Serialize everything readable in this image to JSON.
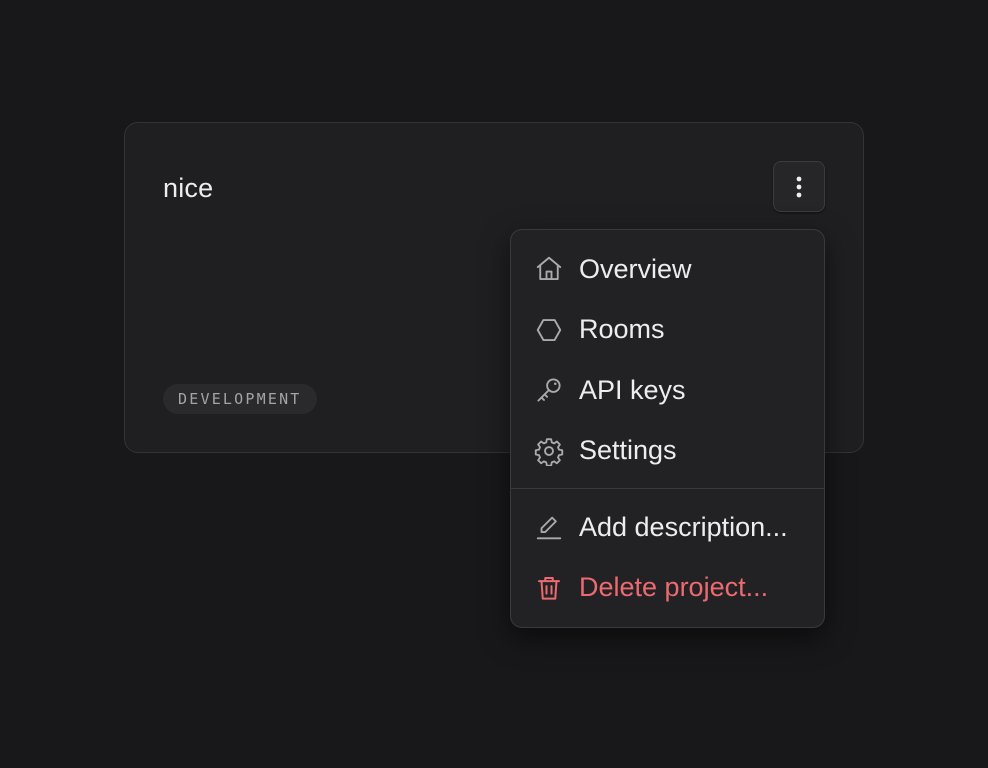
{
  "project": {
    "title": "nice",
    "environment_badge": "DEVELOPMENT"
  },
  "actions_menu": {
    "primary_items": [
      {
        "label": "Overview",
        "icon": "home-icon"
      },
      {
        "label": "Rooms",
        "icon": "hexagon-icon"
      },
      {
        "label": "API keys",
        "icon": "key-icon"
      },
      {
        "label": "Settings",
        "icon": "gear-icon"
      }
    ],
    "secondary_items": [
      {
        "label": "Add description...",
        "icon": "pencil-icon"
      },
      {
        "label": "Delete project...",
        "icon": "trash-icon"
      }
    ]
  },
  "colors": {
    "background": "#18181a",
    "card": "#1f1f21",
    "menu": "#222224",
    "text": "#ededee",
    "muted_text": "#a3a3a8",
    "danger": "#ec6a70"
  },
  "icons": {
    "more_button": "vertical-ellipsis-icon"
  }
}
